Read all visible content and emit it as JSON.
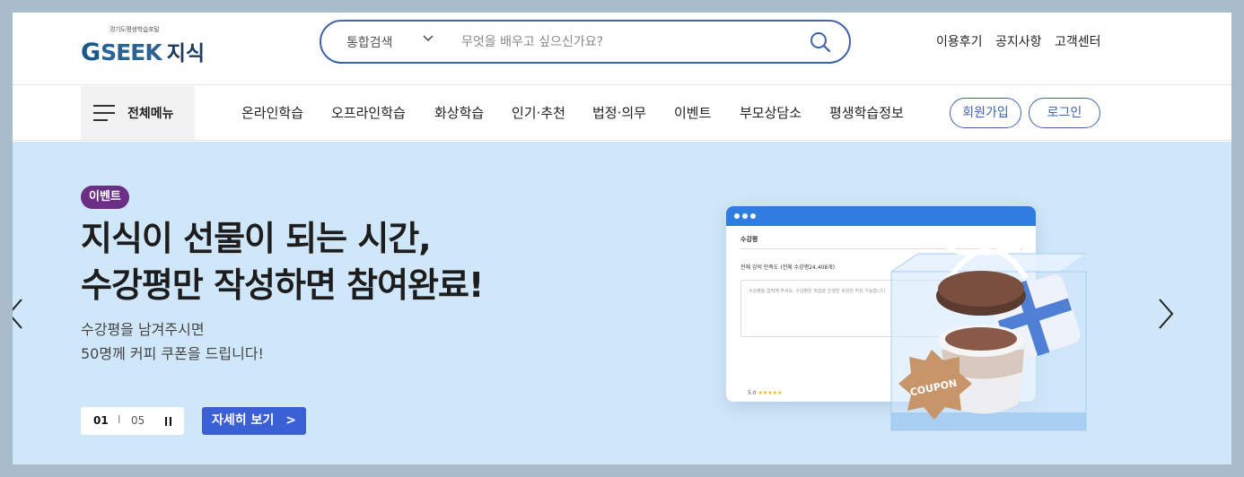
{
  "header": {
    "logo": {
      "tagline": "경기도평생학습포털",
      "brand_g": "G",
      "brand_seek": "SEEK",
      "brand_jisik": "지식"
    },
    "search": {
      "category": "통합검색",
      "placeholder": "무엇을 배우고 싶으신가요?"
    },
    "utility_links": [
      "이용후기",
      "공지사항",
      "고객센터"
    ]
  },
  "nav": {
    "all_menu_label": "전체메뉴",
    "items": [
      "온라인학습",
      "오프라인학습",
      "화상학습",
      "인기·추천",
      "법정·의무",
      "이벤트",
      "부모상담소",
      "평생학습정보"
    ],
    "signup_label": "회원가입",
    "login_label": "로그인"
  },
  "banner": {
    "badge": "이벤트",
    "headline_line1": "지식이 선물이 되는 시간,",
    "headline_line2": "수강평만 작성하면 참여완료!",
    "sub_line1": "수강평을 남겨주시면",
    "sub_line2": "50명께 커피 쿠폰을 드립니다!",
    "pager": {
      "current": "01",
      "separator": "I",
      "total": "05"
    },
    "cta_label": "자세히 보기",
    "cta_arrow": ">",
    "illustration": {
      "review_title": "수강평",
      "review_stat": "전체 강의 만족도 (전체 수강평24,408개)",
      "review_placeholder": "수강평을 입력해 주세요. 수강평은 학습을 진행한 회원만 작성 가능합니다.",
      "rating": "5.0",
      "rating_stars": "★★★★★",
      "coupon_text": "COUPON"
    }
  },
  "colors": {
    "brand_blue": "#3e63ad",
    "badge_purple": "#6b2f86",
    "cta_blue": "#3b5fd4",
    "banner_bg": "#d0e7fa",
    "outer_frame": "#a8bccb"
  },
  "icons": {
    "search": "search-icon",
    "dropdown": "chevron-down-icon",
    "menu": "hamburger-icon",
    "prev": "chevron-left-icon",
    "next": "chevron-right-icon",
    "pause": "pause-icon"
  }
}
